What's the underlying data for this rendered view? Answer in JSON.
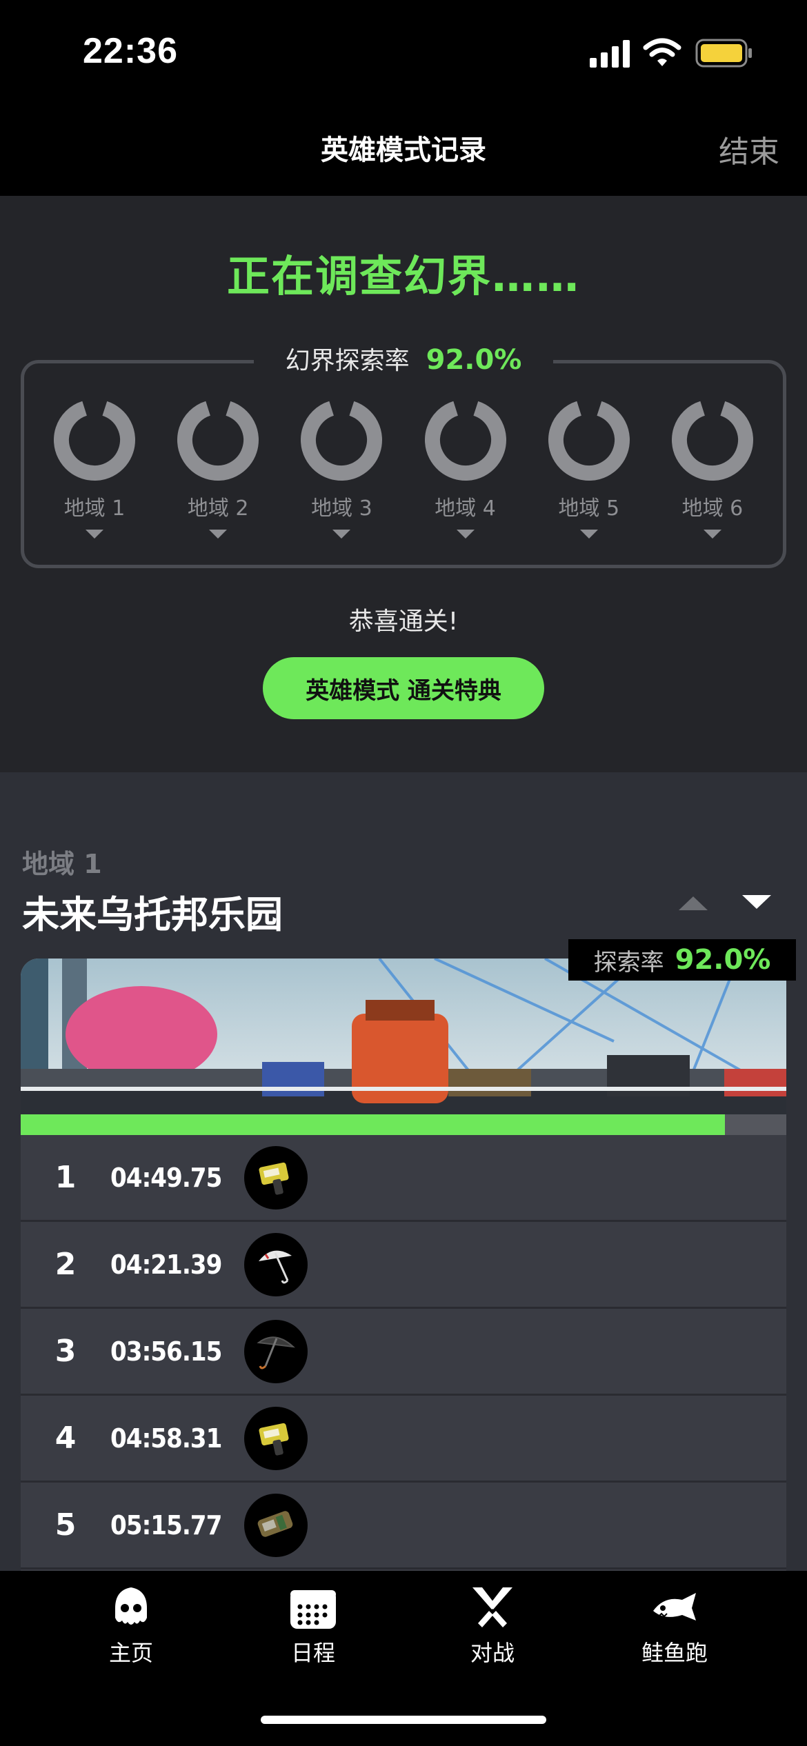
{
  "status_bar": {
    "time": "22:36"
  },
  "header": {
    "title": "英雄模式记录",
    "end_label": "结束"
  },
  "summary": {
    "headline": "正在调查幻界……",
    "explore_rate_label": "幻界探索率",
    "explore_rate_value": "92.0%",
    "regions": [
      {
        "label": "地域 1",
        "completion": 0.9
      },
      {
        "label": "地域 2",
        "completion": 0.9
      },
      {
        "label": "地域 3",
        "completion": 0.9
      },
      {
        "label": "地域 4",
        "completion": 0.9
      },
      {
        "label": "地域 5",
        "completion": 0.9
      },
      {
        "label": "地域 6",
        "completion": 0.9
      }
    ],
    "congrats": "恭喜通关!",
    "reward_button": "英雄模式 通关特典"
  },
  "region_detail": {
    "region_label": "地域 1",
    "region_name": "未来乌托邦乐园",
    "rate_label": "探索率",
    "rate_value": "92.0%",
    "progress": 0.92,
    "levels": [
      {
        "num": "1",
        "time": "04:49.75",
        "weapon_icon": "splatter-shot-icon"
      },
      {
        "num": "2",
        "time": "04:21.39",
        "weapon_icon": "white-umbrella-icon"
      },
      {
        "num": "3",
        "time": "03:56.15",
        "weapon_icon": "black-umbrella-icon"
      },
      {
        "num": "4",
        "time": "04:58.31",
        "weapon_icon": "splatter-shot-icon"
      },
      {
        "num": "5",
        "time": "05:15.77",
        "weapon_icon": "blaster-icon"
      }
    ]
  },
  "tabbar": {
    "tabs": [
      {
        "label": "主页",
        "icon": "squid-icon"
      },
      {
        "label": "日程",
        "icon": "calendar-icon"
      },
      {
        "label": "对战",
        "icon": "crossed-weapons-icon"
      },
      {
        "label": "鲑鱼跑",
        "icon": "salmon-icon"
      }
    ]
  },
  "colors": {
    "accent": "#6ee85a",
    "background": "#242529",
    "card": "#3a3c44"
  }
}
